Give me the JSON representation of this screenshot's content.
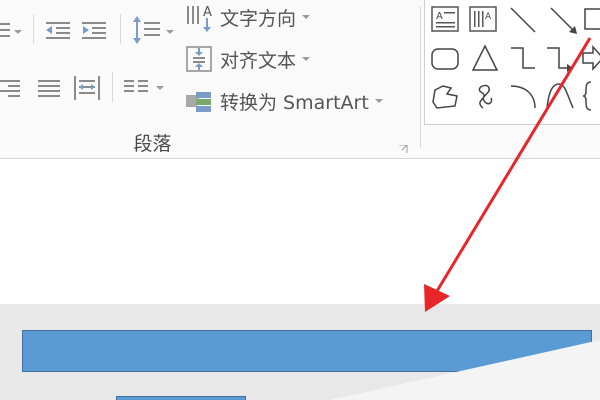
{
  "ribbon": {
    "paragraph_group": {
      "label": "段落",
      "text_direction_label": "文字方向",
      "align_text_label": "对齐文本",
      "convert_smartart_label": "转换为 SmartArt"
    },
    "shapes_gallery": {
      "shapes": [
        "text-box-icon",
        "vertical-text-box-icon",
        "line-icon",
        "arrow-line-icon",
        "rectangle-icon",
        "rounded-rectangle-icon",
        "triangle-icon",
        "elbow-connector-icon",
        "elbow-arrow-connector-icon",
        "block-arrow-icon",
        "freeform-icon",
        "scribble-icon",
        "arc-icon",
        "curve-icon",
        "brace-icon"
      ]
    }
  },
  "document": {
    "shape_fill_color": "#5b9bd5",
    "shape_border_color": "#41719c"
  },
  "annotation": {
    "arrow_color": "#e8262a"
  }
}
